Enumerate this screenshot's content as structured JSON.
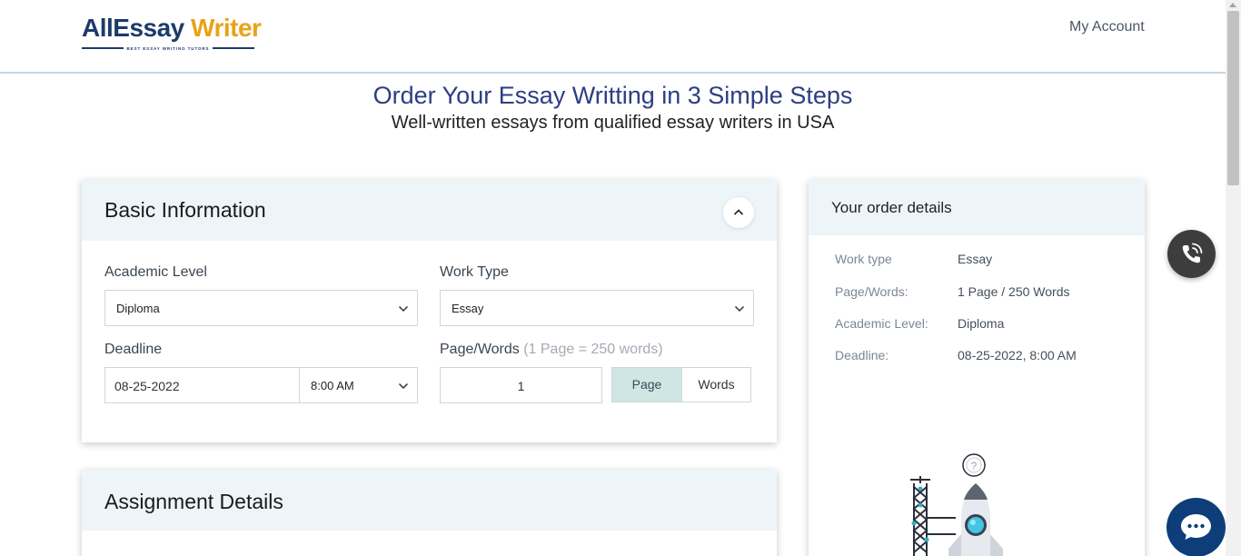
{
  "header": {
    "logo_part1": "All",
    "logo_part2": "Essay",
    "logo_part3": "Writer",
    "logo_tagline": "BEST ESSAY WRITING TUTORS",
    "account_link": "My Account"
  },
  "hero": {
    "title": "Order Your Essay Writting in 3 Simple Steps",
    "subtitle": "Well-written essays from qualified essay writers in USA"
  },
  "basic_info": {
    "title": "Basic Information",
    "academic_level": {
      "label": "Academic Level",
      "value": "Diploma"
    },
    "work_type": {
      "label": "Work Type",
      "value": "Essay"
    },
    "deadline": {
      "label": "Deadline",
      "date": "08-25-2022",
      "time": "8:00 AM"
    },
    "page_words": {
      "label": "Page/Words",
      "hint": "(1 Page = 250 words)",
      "value": "1",
      "toggle_page": "Page",
      "toggle_words": "Words",
      "selected": "Page"
    }
  },
  "assignment": {
    "title": "Assignment Details"
  },
  "order_details": {
    "title": "Your order details",
    "rows": [
      {
        "key": "Work type",
        "value": "Essay"
      },
      {
        "key": "Page/Words:",
        "value": "1 Page / 250 Words"
      },
      {
        "key": "Academic Level:",
        "value": "Diploma"
      },
      {
        "key": "Deadline:",
        "value": "08-25-2022, 8:00 AM"
      }
    ]
  },
  "icons": {
    "collapse": "chevron-up-icon",
    "select_arrow": "chevron-down-icon",
    "call": "phone-icon",
    "chat": "chat-bubble-icon",
    "illustration": "rocket-launch-illustration"
  },
  "colors": {
    "brand_blue": "#1d3a6b",
    "brand_orange": "#e8a317",
    "title_blue": "#2c3e84",
    "card_header_bg": "#eef5f9",
    "toggle_active_bg": "#cfe6e5",
    "chat_button": "#0d3e7a",
    "call_button": "#3d3d3d"
  }
}
